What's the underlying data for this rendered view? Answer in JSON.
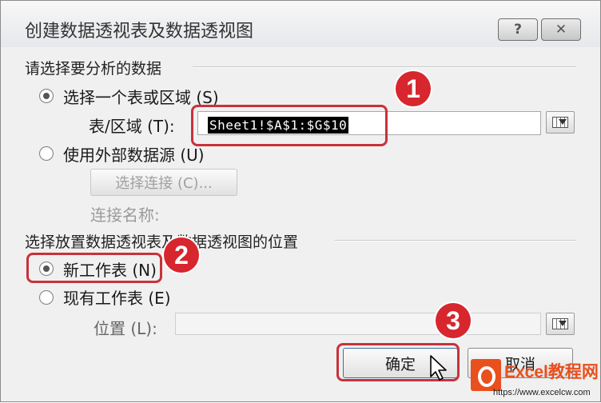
{
  "window": {
    "title": "创建数据透视表及数据透视图",
    "help_label": "?",
    "close_label": "✕"
  },
  "source_group": {
    "title": "请选择要分析的数据",
    "option_table": "选择一个表或区域 (S)",
    "table_range_label": "表/区域 (T):",
    "table_range_value": "Sheet1!$A$1:$G$10",
    "option_external": "使用外部数据源 (U)",
    "choose_connection": "选择连接 (C)...",
    "connection_name_label": "连接名称:"
  },
  "location_group": {
    "title": "选择放置数据透视表及数据透视图的位置",
    "option_new": "新工作表 (N)",
    "option_existing": "现有工作表 (E)",
    "location_label": "位置 (L):",
    "location_value": ""
  },
  "buttons": {
    "ok": "确定",
    "cancel": "取消"
  },
  "annotations": [
    "1",
    "2",
    "3"
  ],
  "state": {
    "selected_source": "table_range",
    "selected_location": "new_worksheet"
  },
  "colors": {
    "highlight": "#c8323a",
    "badge": "#d7262e"
  },
  "watermark": {
    "title": "Excel教程网",
    "url": "https://www.excelcw.com"
  }
}
